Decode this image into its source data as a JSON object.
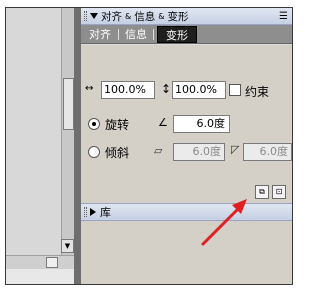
{
  "panel": {
    "title_items": [
      "对齐",
      "信息",
      "变形"
    ],
    "tabs": [
      "对齐",
      "信息",
      "变形"
    ],
    "active_tab": "变形"
  },
  "transform": {
    "width_scale": "100.0%",
    "height_scale": "100.0%",
    "constrain_label": "约束",
    "rotate_label": "旋转",
    "rotate_value": "6.0度",
    "skew_label": "倾斜",
    "skew_h_value": "6.0度",
    "skew_v_value": "6.0度",
    "rotate_selected": true
  },
  "library": {
    "label": "库"
  },
  "colors": {
    "annotation_arrow": "#e02020",
    "active_tab_bg": "#1e1e1e",
    "title_bar": "#c6d0e4"
  }
}
